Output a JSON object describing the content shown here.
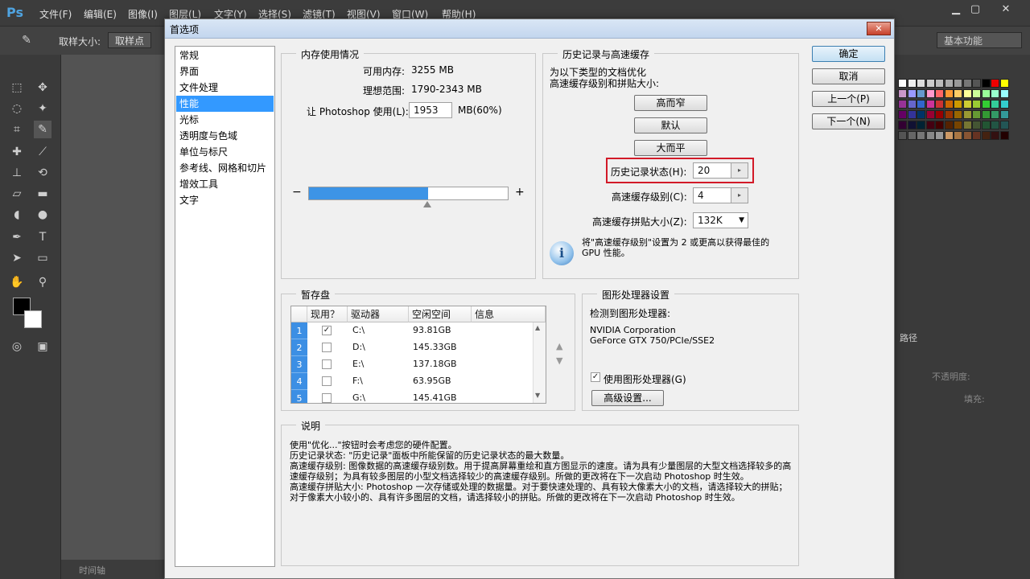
{
  "app": {
    "logo": "Ps",
    "menu": [
      "文件(F)",
      "编辑(E)",
      "图像(I)",
      "图层(L)",
      "文字(Y)",
      "选择(S)",
      "滤镜(T)",
      "视图(V)",
      "窗口(W)",
      "帮助(H)"
    ],
    "options": {
      "sample_size_label": "取样大小:",
      "sample_size_value": "取样点"
    },
    "workspace": "基本功能",
    "right_panel": {
      "paths_tab": "路径",
      "opacity_label": "不透明度:",
      "fill_label": "填充:"
    },
    "timeline_tab": "时间轴"
  },
  "dialog": {
    "title": "首选项",
    "close_glyph": "✕",
    "nav": [
      "常规",
      "界面",
      "文件处理",
      "性能",
      "光标",
      "透明度与色域",
      "单位与标尺",
      "参考线、网格和切片",
      "增效工具",
      "文字"
    ],
    "nav_selected_index": 3,
    "buttons": {
      "ok": "确定",
      "cancel": "取消",
      "prev": "上一个(P)",
      "next": "下一个(N)"
    },
    "memory": {
      "title": "内存使用情况",
      "available_label": "可用内存:",
      "available_value": "3255 MB",
      "ideal_label": "理想范围:",
      "ideal_value": "1790-2343 MB",
      "use_label": "让 Photoshop 使用(L):",
      "use_value": "1953",
      "use_suffix": "MB(60%)",
      "minus": "−",
      "plus": "+",
      "slider_fraction": 0.6
    },
    "history": {
      "title": "历史记录与高速缓存",
      "intro_line1": "为以下类型的文档优化",
      "intro_line2": "高速缓存级别和拼贴大小:",
      "btn_tall_thin": "高而窄",
      "btn_default": "默认",
      "btn_big_flat": "大而平",
      "states_label": "历史记录状态(H):",
      "states_value": "20",
      "cache_levels_label": "高速缓存级别(C):",
      "cache_levels_value": "4",
      "tile_size_label": "高速缓存拼贴大小(Z):",
      "tile_size_value": "132K",
      "note_line1": "将\"高速缓存级别\"设置为 2 或更高以获得最佳的",
      "note_line2": "GPU 性能。"
    },
    "scratch": {
      "title": "暂存盘",
      "columns": [
        "现用？",
        "驱动器",
        "空闲空间",
        "信息"
      ],
      "rows": [
        {
          "num": "1",
          "checked": "✓",
          "drive": "C:\\",
          "free": "93.81GB"
        },
        {
          "num": "2",
          "checked": "",
          "drive": "D:\\",
          "free": "145.33GB"
        },
        {
          "num": "3",
          "checked": "",
          "drive": "E:\\",
          "free": "137.18GB"
        },
        {
          "num": "4",
          "checked": "",
          "drive": "F:\\",
          "free": "63.95GB"
        },
        {
          "num": "5",
          "checked": "",
          "drive": "G:\\",
          "free": "145.41GB"
        }
      ]
    },
    "gpu": {
      "title": "图形处理器设置",
      "detected_label": "检测到图形处理器:",
      "vendor": "NVIDIA Corporation",
      "model": "GeForce GTX 750/PCIe/SSE2",
      "use_gpu_label": "使用图形处理器(G)",
      "use_gpu_checked": "✓",
      "advanced_button": "高级设置..."
    },
    "description": {
      "title": "说明",
      "lines": [
        "使用\"优化...\"按钮时会考虑您的硬件配置。",
        "历史记录状态: \"历史记录\"面板中所能保留的历史记录状态的最大数量。",
        "高速缓存级别: 图像数据的高速缓存级别数。用于提高屏幕重绘和直方图显示的速度。请为具有少量图层的大型文档选择较多的高速缓存级别；为具有较多图层的小型文档选择较少的高速缓存级别。所做的更改将在下一次启动 Photoshop 时生效。",
        "高速缓存拼贴大小: Photoshop 一次存储或处理的数据量。对于要快速处理的、具有较大像素大小的文档，请选择较大的拼贴；对于像素大小较小的、具有许多图层的文档，请选择较小的拼贴。所做的更改将在下一次启动 Photoshop 时生效。"
      ]
    }
  },
  "colors": {
    "accent": "#3399ff",
    "highlight": "#d21a28",
    "ps_dark": "#3a3a3a"
  }
}
